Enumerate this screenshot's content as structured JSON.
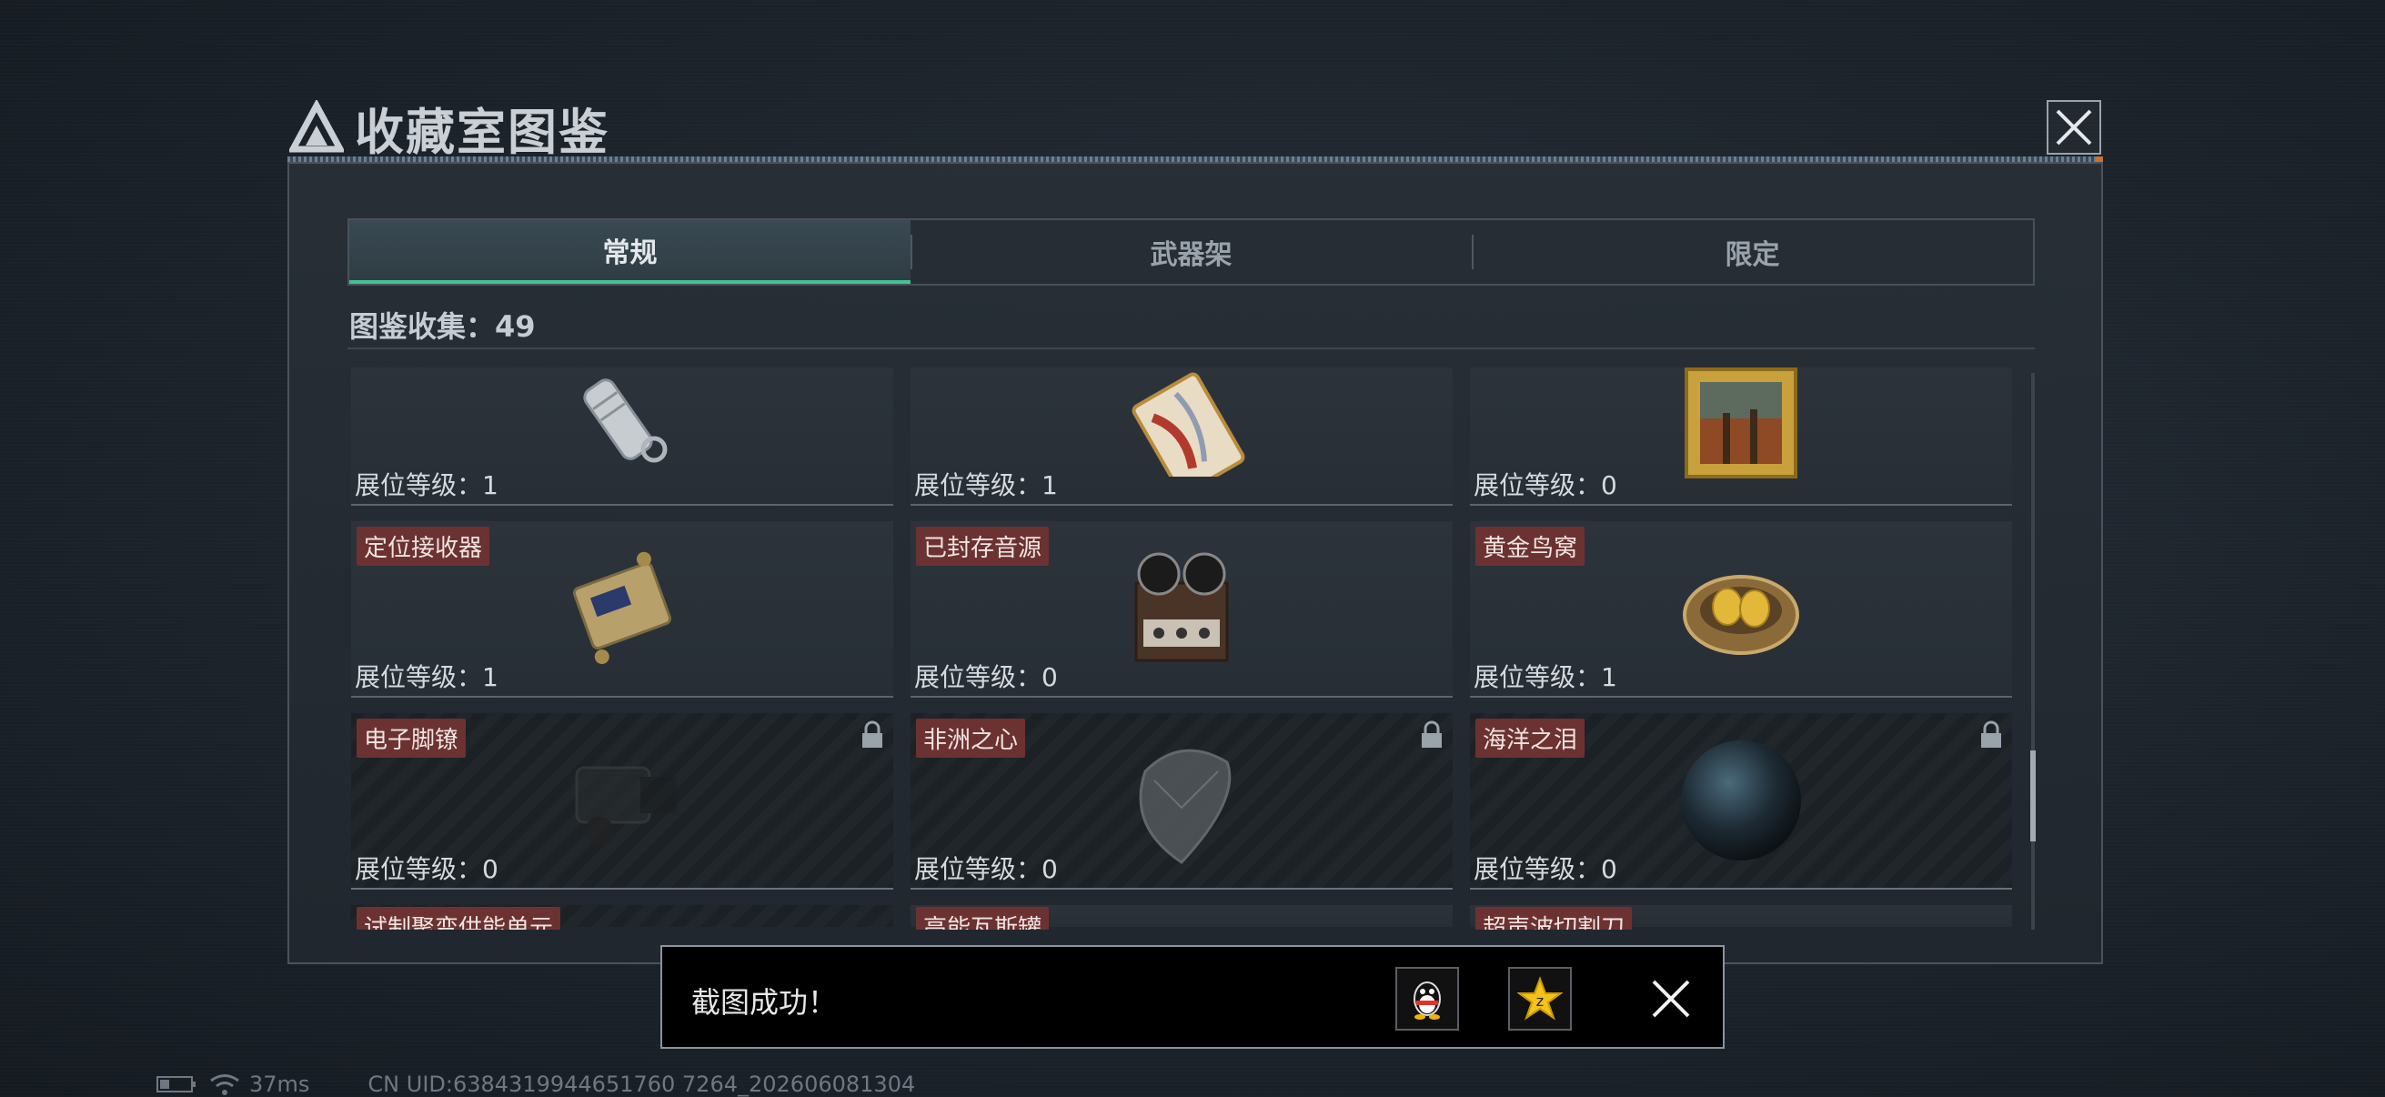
{
  "window": {
    "title": "收藏室图鉴"
  },
  "tabs": [
    {
      "label": "常规",
      "active": true
    },
    {
      "label": "武器架",
      "active": false
    },
    {
      "label": "限定",
      "active": false
    }
  ],
  "collection": {
    "label": "图鉴收集：49"
  },
  "items": [
    {
      "name": "",
      "level": "展位等级：1",
      "locked": false,
      "icon": "flashlight-keychain-icon"
    },
    {
      "name": "",
      "level": "展位等级：1",
      "locked": false,
      "icon": "ornate-card-icon"
    },
    {
      "name": "",
      "level": "展位等级：0",
      "locked": false,
      "icon": "framed-painting-icon"
    },
    {
      "name": "定位接收器",
      "level": "展位等级：1",
      "locked": false,
      "icon": "locator-receiver-icon"
    },
    {
      "name": "已封存音源",
      "level": "展位等级：0",
      "locked": false,
      "icon": "reel-recorder-icon"
    },
    {
      "name": "黄金鸟窝",
      "level": "展位等级：1",
      "locked": false,
      "icon": "golden-nest-icon"
    },
    {
      "name": "电子脚镣",
      "level": "展位等级：0",
      "locked": true,
      "icon": "electronic-anklet-icon"
    },
    {
      "name": "非洲之心",
      "level": "展位等级：0",
      "locked": true,
      "icon": "diamond-icon"
    },
    {
      "name": "海洋之泪",
      "level": "展位等级：0",
      "locked": true,
      "icon": "pearl-icon"
    },
    {
      "name": "试制聚变供能单元",
      "level": "",
      "locked": true,
      "icon": ""
    },
    {
      "name": "高能瓦斯罐",
      "level": "",
      "locked": false,
      "icon": ""
    },
    {
      "name": "超声波切割刀",
      "level": "",
      "locked": false,
      "icon": ""
    }
  ],
  "toast": {
    "message": "截图成功！",
    "share_icons": [
      "qq-penguin-icon",
      "qzone-star-icon"
    ]
  },
  "status": {
    "ping": "37ms",
    "uid": "CN UID:6384319944651760 7264_202606081304"
  },
  "colors": {
    "accent": "#3fc393",
    "name_tag": "#6b3231"
  }
}
